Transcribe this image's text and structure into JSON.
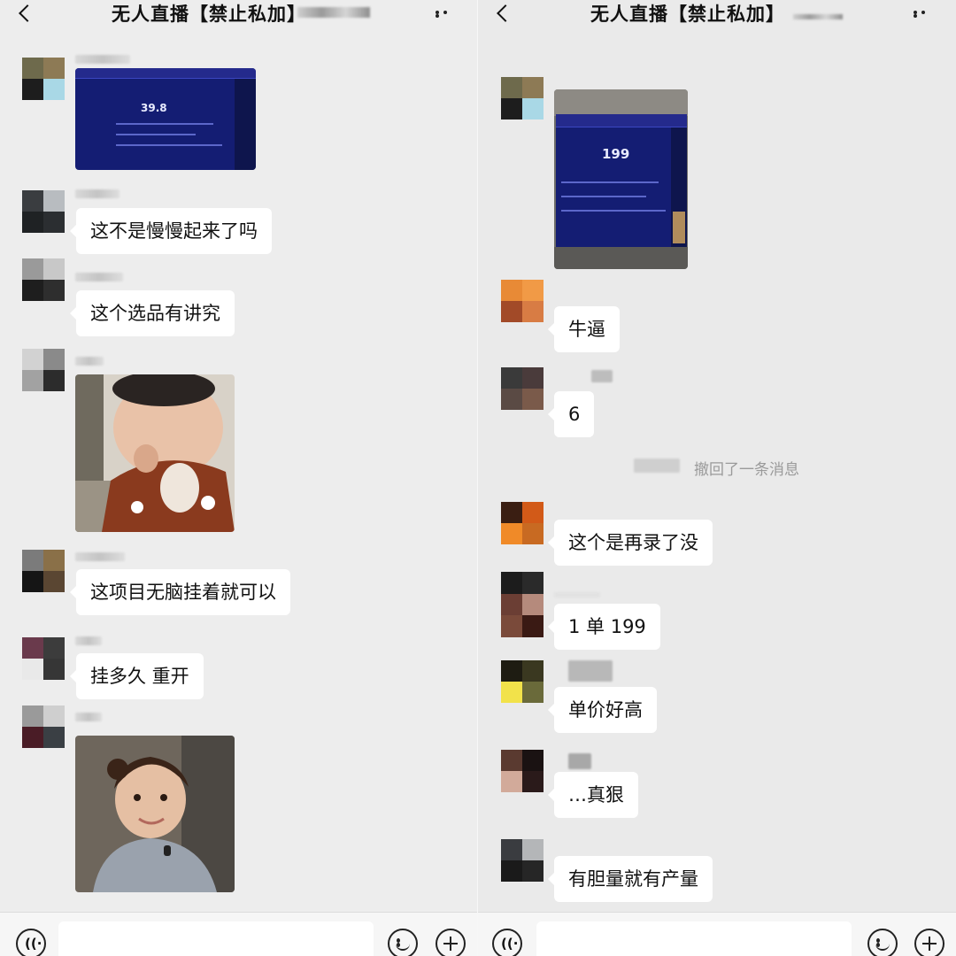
{
  "left": {
    "title": "无人直播【禁止私加】",
    "messages": [
      {
        "type": "image",
        "name": "screenshot-image",
        "screen_value": "39.8"
      },
      {
        "type": "text",
        "text": "这不是慢慢起来了吗"
      },
      {
        "type": "text",
        "text": "这个选品有讲究"
      },
      {
        "type": "image",
        "name": "baby-meme-image"
      },
      {
        "type": "text",
        "text": "这项目无脑挂着就可以"
      },
      {
        "type": "text",
        "text": "挂多久  重开"
      },
      {
        "type": "image",
        "name": "girl-meme-image"
      }
    ]
  },
  "right": {
    "title": "无人直播【禁止私加】",
    "screen_value": "199",
    "recall_text": "撤回了一条消息",
    "messages": [
      {
        "type": "text",
        "text": "牛逼"
      },
      {
        "type": "text",
        "text": "6"
      },
      {
        "type": "text",
        "text": "这个是再录了没"
      },
      {
        "type": "text",
        "text": "1 单 199"
      },
      {
        "type": "text",
        "text": "单价好高"
      },
      {
        "type": "text",
        "text": "…真狠"
      },
      {
        "type": "text",
        "text": "有胆量就有产量"
      }
    ]
  },
  "icons": {
    "back": "chevron-left-icon",
    "more": "more-dots-icon",
    "voice": "voice-icon",
    "emoji": "emoji-icon",
    "plus": "plus-icon"
  },
  "colors": {
    "chat_background": "#ededed",
    "bubble": "#ffffff",
    "screen": "#141d73"
  }
}
